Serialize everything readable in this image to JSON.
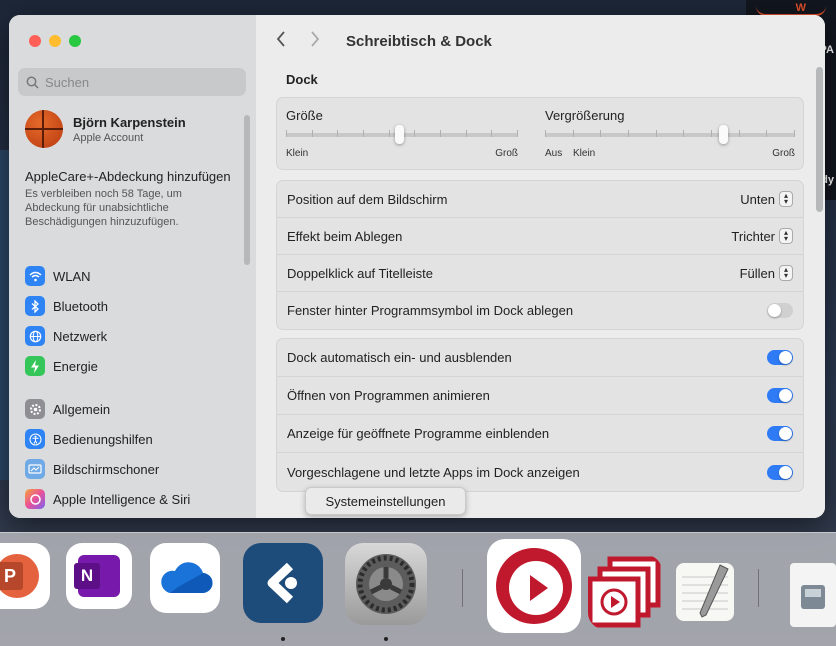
{
  "desktop": {
    "right_window_texts": [
      "W",
      "PA",
      "dy"
    ]
  },
  "sidebar": {
    "search_placeholder": "Suchen",
    "account": {
      "name": "Björn Karpenstein",
      "subtitle": "Apple Account"
    },
    "applecare": {
      "title": "AppleCare+-Abdeckung hinzufügen",
      "description": "Es verbleiben noch 58 Tage, um Abdeckung für unabsichtliche Beschädigungen hinzuzufügen."
    },
    "items_group1": [
      {
        "label": "WLAN",
        "icon": "wifi-icon"
      },
      {
        "label": "Bluetooth",
        "icon": "bluetooth-icon"
      },
      {
        "label": "Netzwerk",
        "icon": "globe-icon"
      },
      {
        "label": "Energie",
        "icon": "bolt-icon"
      }
    ],
    "items_group2": [
      {
        "label": "Allgemein",
        "icon": "gear-icon"
      },
      {
        "label": "Bedienungshilfen",
        "icon": "accessibility-icon"
      },
      {
        "label": "Bildschirmschoner",
        "icon": "screensaver-icon"
      },
      {
        "label": "Apple Intelligence & Siri",
        "icon": "siri-icon"
      }
    ]
  },
  "toolbar": {
    "title": "Schreibtisch & Dock"
  },
  "dock_section": {
    "heading": "Dock",
    "size": {
      "label": "Größe",
      "min_label": "Klein",
      "max_label": "Groß",
      "value": 0.49
    },
    "magnification": {
      "label": "Vergrößerung",
      "off_label": "Aus",
      "min_label": "Klein",
      "max_label": "Groß",
      "value": 0.72
    },
    "popups": [
      {
        "label": "Position auf dem Bildschirm",
        "value": "Unten"
      },
      {
        "label": "Effekt beim Ablegen",
        "value": "Trichter"
      },
      {
        "label": "Doppelklick auf Titelleiste",
        "value": "Füllen"
      }
    ],
    "minimize_into_icon": {
      "label": "Fenster hinter Programmsymbol im Dock ablegen",
      "on": false
    },
    "toggles": [
      {
        "label": "Dock automatisch ein- und ausblenden",
        "on": true
      },
      {
        "label": "Öffnen von Programmen animieren",
        "on": true
      },
      {
        "label": "Anzeige für geöffnete Programme einblenden",
        "on": true
      },
      {
        "label": "Vorgeschlagene und letzte Apps im Dock anzeigen",
        "on": true
      }
    ]
  },
  "tooltip": {
    "text": "Systemeinstellungen"
  },
  "dock": {
    "powerpoint_letter": "P",
    "onenote_letter": "N"
  },
  "colors": {
    "accent": "#2f7bf5",
    "sidebar": "#d9dbdc",
    "content": "#ececec"
  }
}
